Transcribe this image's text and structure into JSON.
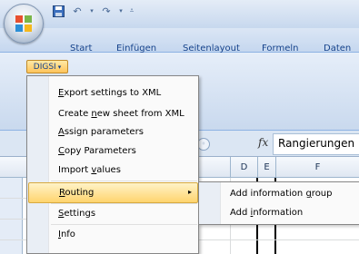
{
  "quick_access": {
    "icons": [
      "save-icon",
      "undo-icon",
      "redo-icon",
      "customize-icon"
    ]
  },
  "tabs": [
    "Start",
    "Einfügen",
    "Seitenlayout",
    "Formeln",
    "Daten"
  ],
  "addin": {
    "label": "DIGSI",
    "arrow": "▾"
  },
  "menu": {
    "items": [
      {
        "pre": "",
        "key": "E",
        "post": "xport settings to XML"
      },
      {
        "pre": "Create ",
        "key": "n",
        "post": "ew sheet from XML"
      },
      {
        "pre": "",
        "key": "A",
        "post": "ssign parameters"
      },
      {
        "pre": "",
        "key": "C",
        "post": "opy Parameters"
      },
      {
        "pre": "Import ",
        "key": "v",
        "post": "alues"
      },
      {
        "pre": "",
        "key": "R",
        "post": "outing"
      },
      {
        "pre": "",
        "key": "S",
        "post": "ettings"
      },
      {
        "pre": "",
        "key": "I",
        "post": "nfo"
      }
    ],
    "active_index": 5,
    "submenu_arrow": "▸"
  },
  "submenu": {
    "items": [
      {
        "pre": "Add information ",
        "key": "g",
        "post": "roup"
      },
      {
        "pre": "Add ",
        "key": "i",
        "post": "nformation"
      }
    ]
  },
  "formula": {
    "fx_label": "fx",
    "value": "Rangierungen"
  },
  "columns": [
    "D",
    "E",
    "F"
  ]
}
